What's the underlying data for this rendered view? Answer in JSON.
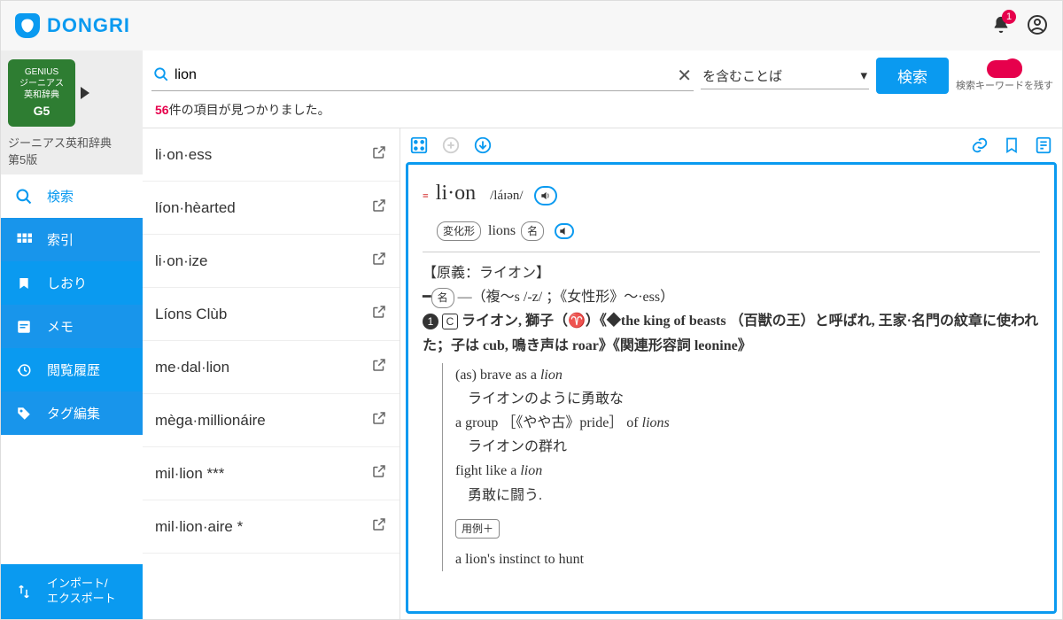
{
  "brand": "DONGRI",
  "notifications": {
    "count": "1"
  },
  "dictionary": {
    "cover_text1": "GENIUS",
    "cover_text2": "ジーニアス",
    "cover_text3": "英和辞典",
    "cover_text4": "G5",
    "name": "ジーニアス英和辞典\n第5版"
  },
  "sidebar": {
    "items": [
      {
        "label": "検索"
      },
      {
        "label": "索引"
      },
      {
        "label": "しおり"
      },
      {
        "label": "メモ"
      },
      {
        "label": "閲覧履歴"
      },
      {
        "label": "タグ編集"
      },
      {
        "label": "インポート/\nエクスポート"
      }
    ]
  },
  "search": {
    "query": "lion",
    "mode": "を含むことば",
    "button": "検索",
    "toggle_label": "検索キーワードを残す"
  },
  "results": {
    "count": "56",
    "suffix": "件の項目が見つかりました。"
  },
  "list": [
    {
      "word": "li·on·ess"
    },
    {
      "word": "líon·hèarted"
    },
    {
      "word": "li·on·ize"
    },
    {
      "word": "Líons Clùb"
    },
    {
      "word": "me·dal·lion"
    },
    {
      "word": "mèga·millionáire"
    },
    {
      "word": "mil·lion ***"
    },
    {
      "word": "mil·lion·aire *"
    }
  ],
  "entry": {
    "headword": "li·on",
    "pron": "/láɪən/",
    "inflection_label": "変化形",
    "inflection": "lions",
    "inflection_pos": "名",
    "etymology": "【原義：ライオン】",
    "forms_line": "—（複〜s /-z/ ；《女性形》〜·ess）",
    "pos_label": "名",
    "countable_label": "C",
    "sense1": "ライオン, 獅子（♈）《◆the king of beasts （百獣の王）と呼ばれ, 王家·名門の紋章に使われた；子は cub, 鳴き声は roar》《関連形容詞 leonine》",
    "examples": [
      {
        "en_pre": "(as)  brave as a ",
        "en_it": "lion",
        "jp": "ライオンのように勇敢な"
      },
      {
        "en_pre": "a group ［《やや古》pride］ of ",
        "en_it": "lions",
        "jp": "ライオンの群れ"
      },
      {
        "en_pre": "fight like a ",
        "en_it": "lion",
        "jp": "勇敢に闘う."
      }
    ],
    "more_examples_tag": "用例＋",
    "example_tail": "a lion's instinct to hunt"
  }
}
